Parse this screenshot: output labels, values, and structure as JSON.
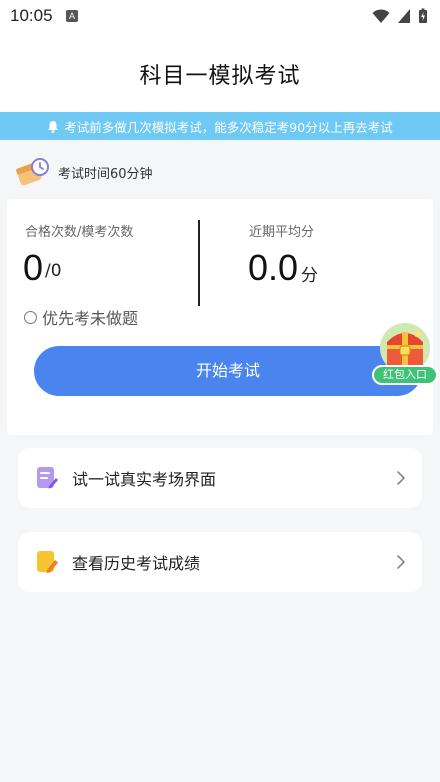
{
  "status_bar": {
    "time": "10:05",
    "app_icon_letter": "A",
    "icons": [
      "wifi-icon",
      "signal-icon",
      "battery-icon"
    ]
  },
  "header": {
    "title": "科目一模拟考试"
  },
  "notice": {
    "icon": "bell-icon",
    "text": "考试前多做几次模拟考试，能多次稳定考90分以上再去考试",
    "bg_color": "#6ec9f4"
  },
  "exam_time": {
    "icon": "clock-calendar-icon",
    "label": "考试时间60分钟"
  },
  "stats": {
    "pass_label": "合格次数/模考次数",
    "pass_count": "0",
    "exam_count": "/0",
    "avg_label": "近期平均分",
    "avg_score": "0.0",
    "avg_unit": "分"
  },
  "option": {
    "label": "优先考未做题",
    "checked": false
  },
  "start_button": {
    "label": "开始考试",
    "color": "#4a84ef"
  },
  "red_packet": {
    "icon": "treasure-chest-icon",
    "label": "红包入口"
  },
  "menu": [
    {
      "icon": "document-edit-icon",
      "label": "试一试真实考场界面"
    },
    {
      "icon": "note-pencil-icon",
      "label": "查看历史考试成绩"
    }
  ]
}
